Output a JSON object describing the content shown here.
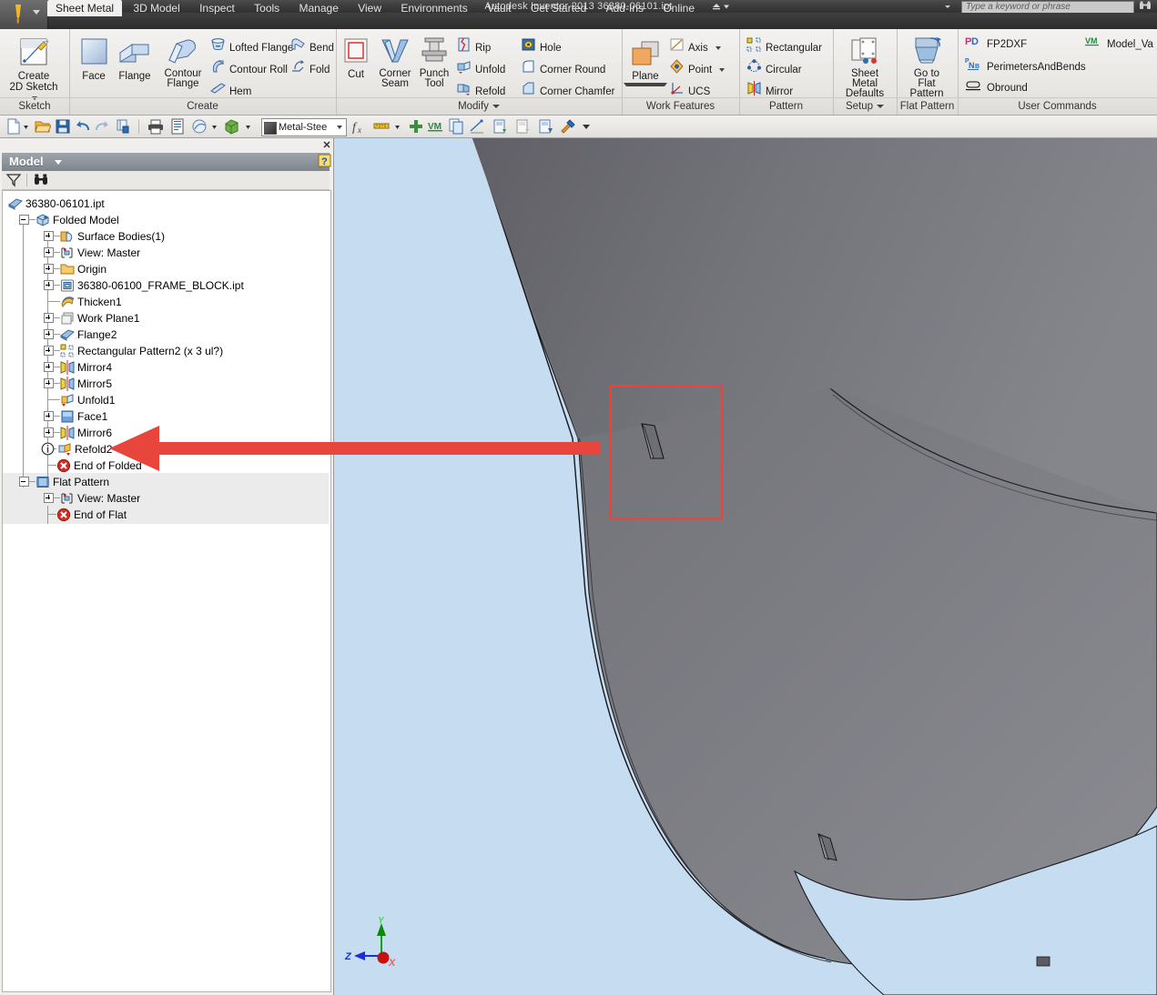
{
  "window": {
    "title": "Autodesk Inventor 2013    36380-06101.ipt",
    "app_button_name": "Inventor application menu",
    "search_placeholder": "Type a keyword or phrase",
    "search_value": ""
  },
  "ribbon": {
    "tabs": [
      {
        "label": "Sheet Metal",
        "active": true
      },
      {
        "label": "3D Model",
        "active": false
      },
      {
        "label": "Inspect",
        "active": false
      },
      {
        "label": "Tools",
        "active": false
      },
      {
        "label": "Manage",
        "active": false
      },
      {
        "label": "View",
        "active": false
      },
      {
        "label": "Environments",
        "active": false
      },
      {
        "label": "Vault",
        "active": false
      },
      {
        "label": "Get Started",
        "active": false
      },
      {
        "label": "Add-Ins",
        "active": false
      },
      {
        "label": "Online",
        "active": false
      }
    ],
    "panels": [
      {
        "label": "Sketch",
        "has_dropdown": false
      },
      {
        "label": "Create",
        "has_dropdown": false
      },
      {
        "label": "Modify",
        "has_dropdown": true
      },
      {
        "label": "Work Features",
        "has_dropdown": false
      },
      {
        "label": "Pattern",
        "has_dropdown": false
      },
      {
        "label": "Setup",
        "has_dropdown": true
      },
      {
        "label": "Flat Pattern",
        "has_dropdown": false
      },
      {
        "label": "User Commands",
        "has_dropdown": false
      }
    ],
    "sketch": {
      "create_2d_sketch": "Create\n2D Sketch"
    },
    "create": {
      "face": "Face",
      "flange": "Flange",
      "contour_flange": "Contour\nFlange",
      "lofted_flange": "Lofted Flange",
      "contour_roll": "Contour Roll",
      "hem": "Hem",
      "bend": "Bend",
      "fold": "Fold"
    },
    "modify": {
      "cut": "Cut",
      "corner_seam": "Corner\nSeam",
      "punch_tool": "Punch\nTool",
      "rip": "Rip",
      "unfold": "Unfold",
      "refold": "Refold",
      "hole": "Hole",
      "corner_round": "Corner Round",
      "corner_chamfer": "Corner Chamfer"
    },
    "work_features": {
      "plane": "Plane",
      "axis": "Axis",
      "point": "Point",
      "ucs": "UCS"
    },
    "pattern": {
      "rectangular": "Rectangular",
      "circular": "Circular",
      "mirror": "Mirror"
    },
    "setup": {
      "sheet_metal_defaults": "Sheet Metal\nDefaults"
    },
    "flat_pattern": {
      "go_to_flat_pattern": "Go to\nFlat Pattern"
    },
    "user_commands": [
      {
        "label": "FP2DXF",
        "badge": "PD"
      },
      {
        "label": "PerimetersAndBends",
        "badge": "PNB"
      },
      {
        "label": "Obround",
        "badge": "obround"
      },
      {
        "label": "Model_Va",
        "badge": "VM"
      }
    ]
  },
  "quick_access": {
    "material_value": "Metal-Stee",
    "items": [
      "new-icon",
      "open-icon",
      "save-icon",
      "undo-icon",
      "redo-icon",
      "update-icon",
      "print-icon",
      "print-preview-icon",
      "appearance-icon",
      "return-icon",
      "parameters-icon",
      "measure-icon",
      "add-icon",
      "model-value-icon",
      "copy-icon",
      "sketch-dim-icon",
      "view1-icon",
      "view2-icon",
      "view3-icon",
      "tools-icon"
    ]
  },
  "browser": {
    "title": "Model",
    "filter_icon": "filter-icon",
    "find_icon": "find-icon",
    "help_icon": "help-icon",
    "close_icon": "close-icon",
    "tree": [
      {
        "label": "36380-06101.ipt",
        "depth": 0,
        "icon": "part-icon",
        "expander": "none",
        "shaded": false
      },
      {
        "label": "Folded Model",
        "depth": 1,
        "icon": "folded-model-icon",
        "expander": "minus",
        "shaded": false
      },
      {
        "label": "Surface Bodies(1)",
        "depth": 2,
        "icon": "surface-bodies-icon",
        "expander": "plus",
        "shaded": false
      },
      {
        "label": "View: Master",
        "depth": 2,
        "icon": "view-icon",
        "expander": "plus",
        "shaded": false
      },
      {
        "label": "Origin",
        "depth": 2,
        "icon": "folder-icon",
        "expander": "plus",
        "shaded": false
      },
      {
        "label": "36380-06100_FRAME_BLOCK.ipt",
        "depth": 2,
        "icon": "derived-part-icon",
        "expander": "plus",
        "shaded": false
      },
      {
        "label": "Thicken1",
        "depth": 2,
        "icon": "thicken-icon",
        "expander": "none",
        "shaded": false
      },
      {
        "label": "Work Plane1",
        "depth": 2,
        "icon": "work-plane-icon",
        "expander": "plus",
        "shaded": false
      },
      {
        "label": "Flange2",
        "depth": 2,
        "icon": "flange-icon",
        "expander": "plus",
        "shaded": false
      },
      {
        "label": "Rectangular Pattern2 (x 3 ul?)",
        "depth": 2,
        "icon": "rect-pattern-icon",
        "expander": "plus",
        "shaded": false
      },
      {
        "label": "Mirror4",
        "depth": 2,
        "icon": "mirror-icon",
        "expander": "plus",
        "shaded": false
      },
      {
        "label": "Mirror5",
        "depth": 2,
        "icon": "mirror-icon",
        "expander": "plus",
        "shaded": false
      },
      {
        "label": "Unfold1",
        "depth": 2,
        "icon": "unfold-icon",
        "expander": "none",
        "shaded": false
      },
      {
        "label": "Face1",
        "depth": 2,
        "icon": "face-icon",
        "expander": "plus",
        "shaded": false
      },
      {
        "label": "Mirror6",
        "depth": 2,
        "icon": "mirror-icon",
        "expander": "plus",
        "shaded": false
      },
      {
        "label": "Refold2",
        "depth": 2,
        "icon": "refold-icon",
        "expander": "none",
        "shaded": false,
        "info_badge": true
      },
      {
        "label": "End of Folded",
        "depth": 2,
        "icon": "end-of-features-icon",
        "expander": "none",
        "shaded": false
      },
      {
        "label": "Flat Pattern",
        "depth": 1,
        "icon": "flat-pattern-icon",
        "expander": "minus",
        "shaded": true
      },
      {
        "label": "View: Master",
        "depth": 2,
        "icon": "view-icon",
        "expander": "plus",
        "shaded": true
      },
      {
        "label": "End of Flat",
        "depth": 2,
        "icon": "end-of-features-icon",
        "expander": "none",
        "shaded": true
      }
    ]
  },
  "viewport": {
    "background_color": "#c6dcf0",
    "part_color": "#7d7d83",
    "highlight_rect_color": "#ef4136",
    "annotation_arrow_color": "#e74c3c",
    "axes": {
      "x": "X",
      "y": "Y",
      "z": "Z"
    }
  }
}
